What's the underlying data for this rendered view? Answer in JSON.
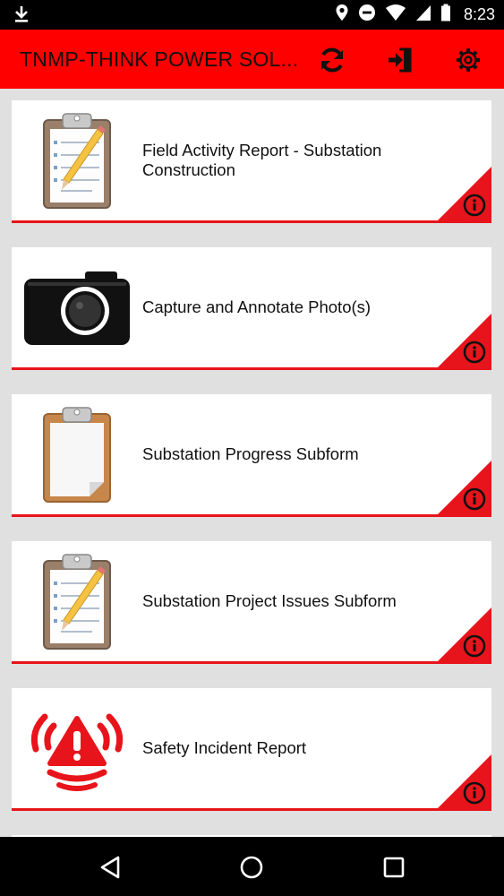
{
  "status_bar": {
    "time": "8:23",
    "icons": [
      "download-icon",
      "location-icon",
      "do-not-disturb-icon",
      "wifi-icon",
      "cell-signal-icon",
      "battery-icon"
    ]
  },
  "app_bar": {
    "title": "TNMP-THINK POWER SOL...",
    "background": "#ff0000",
    "actions": [
      "refresh-icon",
      "logout-icon",
      "settings-icon"
    ]
  },
  "forms": [
    {
      "label": "Field Activity Report - Substation Construction",
      "icon": "clipboard-pencil-icon"
    },
    {
      "label": "Capture and Annotate Photo(s)",
      "icon": "camera-icon"
    },
    {
      "label": "Substation Progress Subform",
      "icon": "clipboard-blank-icon"
    },
    {
      "label": "Substation Project Issues Subform",
      "icon": "clipboard-pencil-icon"
    },
    {
      "label": "Safety Incident Report",
      "icon": "alert-signal-icon"
    }
  ],
  "accent_color": "#e8141b",
  "nav_bar": [
    "back-icon",
    "home-icon",
    "recents-icon"
  ]
}
